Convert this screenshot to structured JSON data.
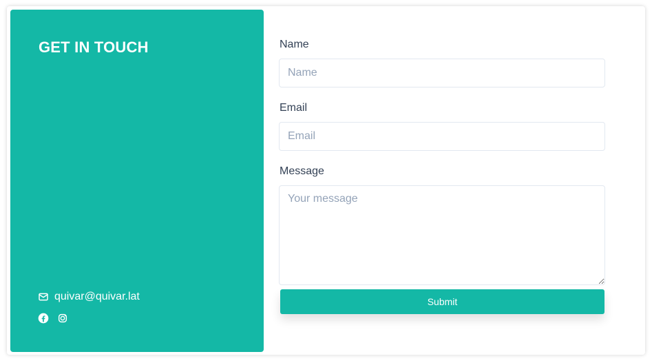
{
  "contact": {
    "title": "GET IN TOUCH",
    "email": "quivar@quivar.lat",
    "icons": {
      "email": "envelope-icon",
      "facebook": "facebook-icon",
      "instagram": "instagram-icon"
    }
  },
  "form": {
    "name_label": "Name",
    "name_placeholder": "Name",
    "email_label": "Email",
    "email_placeholder": "Email",
    "message_label": "Message",
    "message_placeholder": "Your message",
    "submit_label": "Submit"
  },
  "colors": {
    "accent": "#14b8a6",
    "text": "#334155",
    "placeholder": "#94a3b8",
    "border": "#e2e8f0"
  }
}
